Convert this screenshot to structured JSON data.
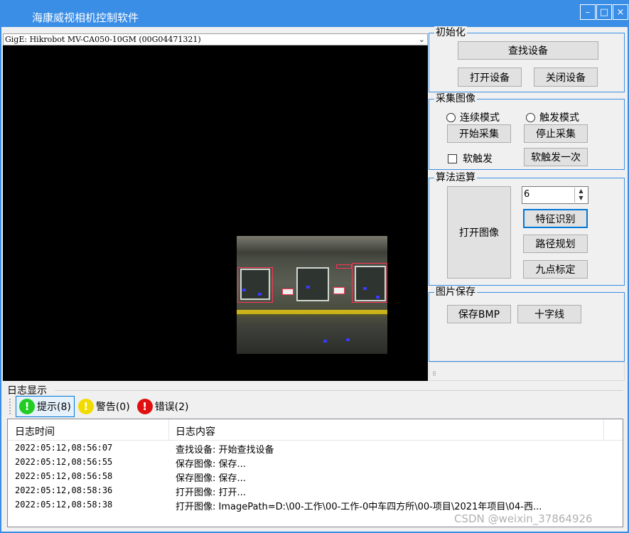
{
  "window": {
    "title": "海康威视相机控制软件",
    "buttons": {
      "minimize": "–",
      "maximize": "□",
      "close": "×"
    }
  },
  "camera": {
    "device": "GigE: Hikrobot MV-CA050-10GM (00G04471321)"
  },
  "init_group": {
    "title": "初始化",
    "find_devices": "查找设备",
    "open_device": "打开设备",
    "close_device": "关闭设备"
  },
  "capture_group": {
    "title": "采集图像",
    "continuous_mode": "连续模式",
    "trigger_mode": "触发模式",
    "start_capture": "开始采集",
    "stop_capture": "停止采集",
    "soft_trigger": "软触发",
    "soft_trigger_once": "软触发一次"
  },
  "algo_group": {
    "title": "算法运算",
    "open_image": "打开图像",
    "spin_value": "6",
    "feature_recognition": "特征识别",
    "path_planning": "路径规划",
    "nine_point_calibration": "九点标定"
  },
  "save_group": {
    "title": "图片保存",
    "save_bmp": "保存BMP",
    "crosshair": "十字线"
  },
  "log": {
    "title": "日志显示",
    "tabs": [
      {
        "label": "提示(8)",
        "icon": "info-icon",
        "color": "#22cc22"
      },
      {
        "label": "警告(0)",
        "icon": "warning-icon",
        "color": "#f2dc00"
      },
      {
        "label": "错误(2)",
        "icon": "error-icon",
        "color": "#e01010"
      }
    ],
    "columns": [
      "日志时间",
      "日志内容"
    ],
    "rows": [
      {
        "time": "2022:05:12,08:56:07",
        "content": "查找设备: 开始查找设备"
      },
      {
        "time": "2022:05:12,08:56:55",
        "content": "保存图像: 保存..."
      },
      {
        "time": "2022:05:12,08:56:58",
        "content": "保存图像: 保存..."
      },
      {
        "time": "2022:05:12,08:58:36",
        "content": "打开图像: 打开..."
      },
      {
        "time": "2022:05:12,08:58:38",
        "content": "打开图像: ImagePath=D:\\00-工作\\00-工作-0中车四方所\\00-项目\\2021年项目\\04-西..."
      }
    ]
  },
  "watermark": "CSDN @weixin_37864926"
}
